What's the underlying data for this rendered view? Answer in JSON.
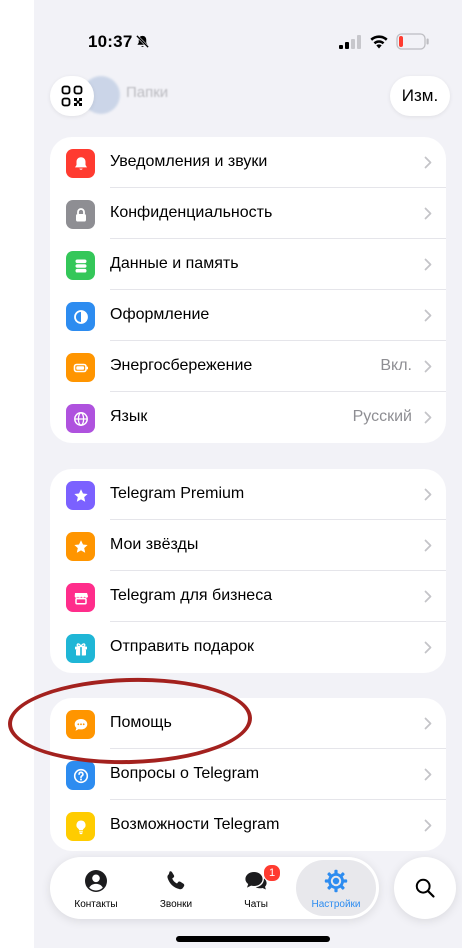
{
  "status_bar": {
    "time": "10:37",
    "icons": [
      "bell-slash-icon",
      "signal-icon",
      "wifi-icon",
      "battery-low-icon"
    ],
    "battery_color": "#ff3b30"
  },
  "header": {
    "qr_icon": "qr-code-icon",
    "edit_label": "Изм.",
    "background_folder_text": "Папки"
  },
  "groups": [
    {
      "rows": [
        {
          "label": "Уведомления и звуки",
          "value": "",
          "icon": "bell-icon",
          "color": "#ff3b30"
        },
        {
          "label": "Конфиденциальность",
          "value": "",
          "icon": "lock-icon",
          "color": "#8e8e93"
        },
        {
          "label": "Данные и память",
          "value": "",
          "icon": "database-icon",
          "color": "#34c759"
        },
        {
          "label": "Оформление",
          "value": "",
          "icon": "appearance-icon",
          "color": "#2d8cf0"
        },
        {
          "label": "Энергосбережение",
          "value": "Вкл.",
          "icon": "battery-icon",
          "color": "#ff9500"
        },
        {
          "label": "Язык",
          "value": "Русский",
          "icon": "globe-icon",
          "color": "#af52de"
        }
      ]
    },
    {
      "rows": [
        {
          "label": "Telegram Premium",
          "value": "",
          "icon": "star-icon",
          "color": "#7b61ff"
        },
        {
          "label": "Мои звёзды",
          "value": "",
          "icon": "star-icon",
          "color": "#ff9500"
        },
        {
          "label": "Telegram для бизнеса",
          "value": "",
          "icon": "store-icon",
          "color": "#ff2d8b"
        },
        {
          "label": "Отправить подарок",
          "value": "",
          "icon": "gift-icon",
          "color": "#1fb6d6"
        }
      ]
    },
    {
      "rows": [
        {
          "label": "Помощь",
          "value": "",
          "icon": "chat-bubble-icon",
          "color": "#ff9500"
        },
        {
          "label": "Вопросы о Telegram",
          "value": "",
          "icon": "question-icon",
          "color": "#2d8cf0"
        },
        {
          "label": "Возможности Telegram",
          "value": "",
          "icon": "lightbulb-icon",
          "color": "#ffcc00"
        }
      ]
    }
  ],
  "tabbar": {
    "tabs": [
      {
        "label": "Контакты",
        "icon": "person-icon",
        "active": false
      },
      {
        "label": "Звонки",
        "icon": "phone-icon",
        "active": false
      },
      {
        "label": "Чаты",
        "icon": "chats-icon",
        "active": false,
        "badge": "1"
      },
      {
        "label": "Настройки",
        "icon": "gear-icon",
        "active": true
      }
    ],
    "accent": "#2d8cf0",
    "search_icon": "search-icon"
  },
  "annotation": {
    "highlighted_item": "Помощь",
    "color": "#a3211e"
  }
}
